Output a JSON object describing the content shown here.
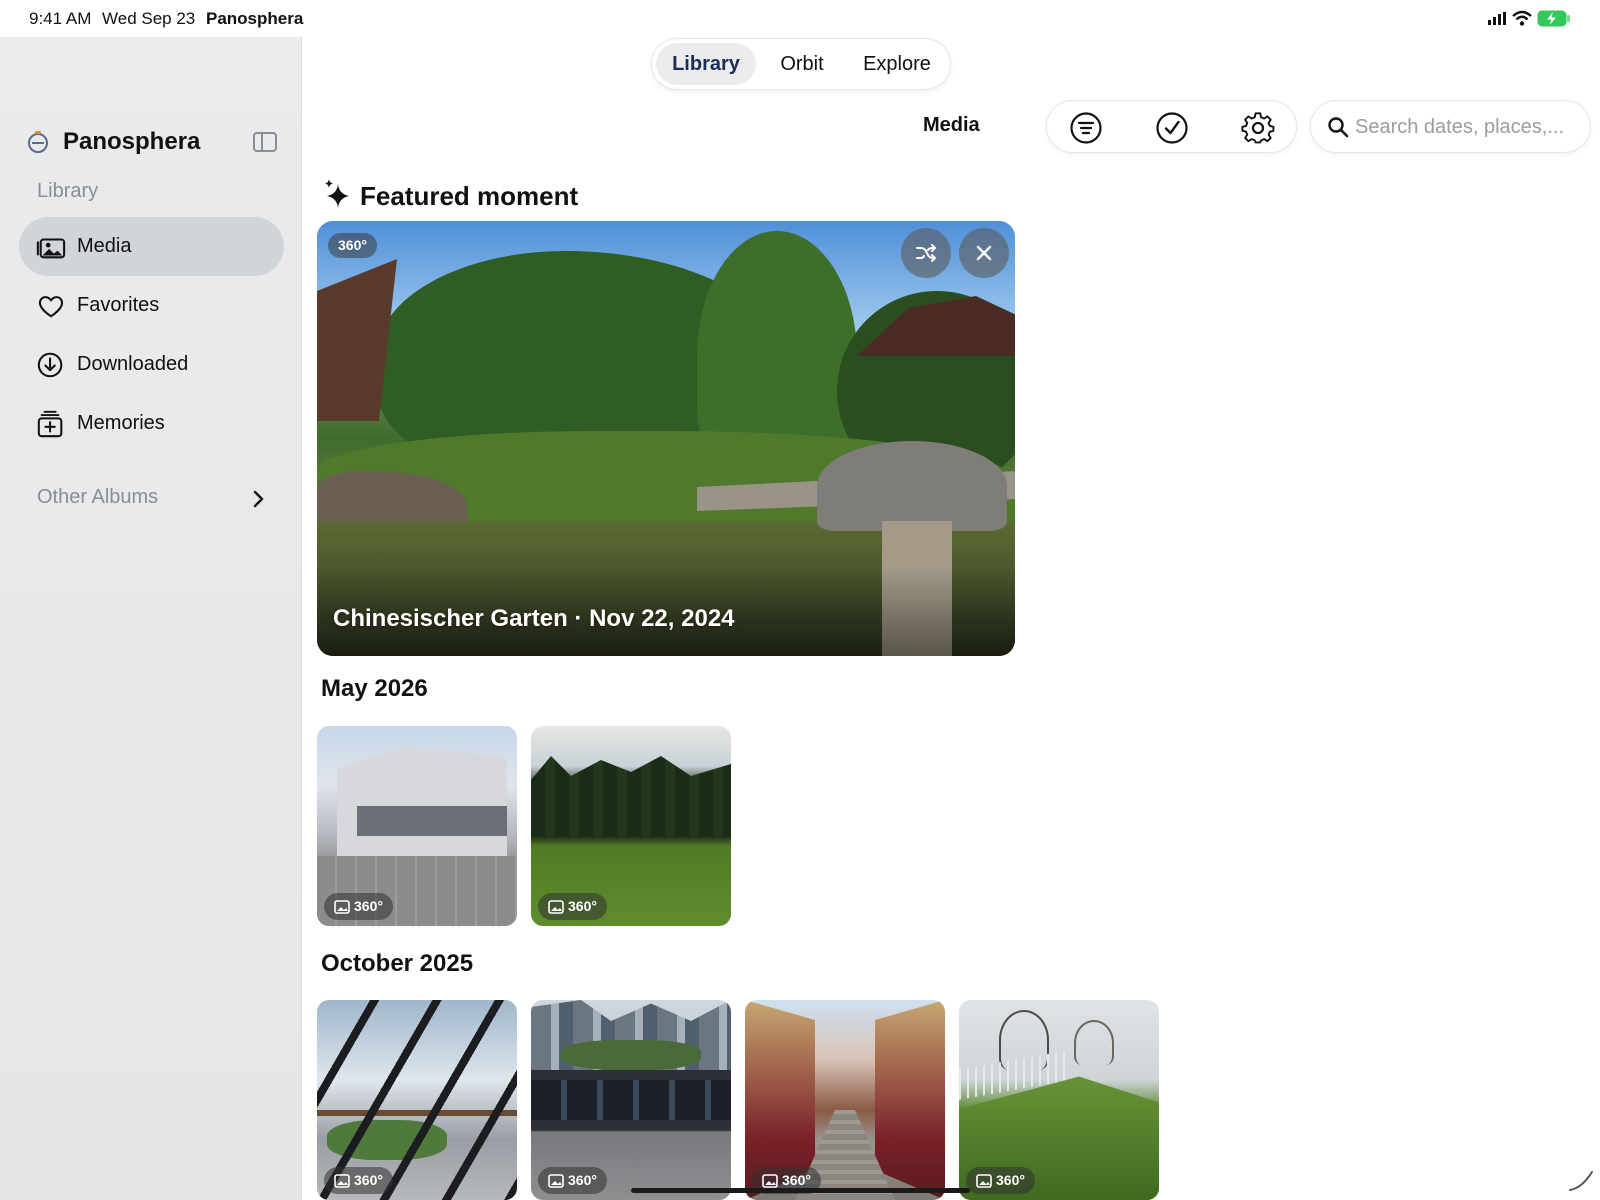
{
  "status_bar": {
    "time": "9:41 AM",
    "date": "Wed Sep 23",
    "app_name": "Panosphera"
  },
  "sidebar": {
    "title": "Panosphera",
    "section_label": "Library",
    "items": [
      {
        "label": "Media",
        "icon": "photo-stack-icon",
        "active": true
      },
      {
        "label": "Favorites",
        "icon": "heart-icon",
        "active": false
      },
      {
        "label": "Downloaded",
        "icon": "download-circle-icon",
        "active": false
      },
      {
        "label": "Memories",
        "icon": "memories-icon",
        "active": false
      }
    ],
    "other_albums_label": "Other Albums"
  },
  "top_tabs": [
    {
      "label": "Library",
      "active": true
    },
    {
      "label": "Orbit",
      "active": false
    },
    {
      "label": "Explore",
      "active": false
    }
  ],
  "toolbar": {
    "title": "Media",
    "buttons": [
      "filter-icon",
      "select-checkmark-icon",
      "settings-gear-icon"
    ],
    "search_placeholder": "Search dates, places,..."
  },
  "featured": {
    "heading": "Featured moment",
    "badge": "360°",
    "caption": "Chinesischer Garten · Nov 22, 2024"
  },
  "sections": [
    {
      "title": "May 2026",
      "items": [
        {
          "badge": "360°",
          "scene": "building"
        },
        {
          "badge": "360°",
          "scene": "meadow"
        }
      ]
    },
    {
      "title": "October 2025",
      "items": [
        {
          "badge": "360°",
          "scene": "glass"
        },
        {
          "badge": "360°",
          "scene": "wall"
        },
        {
          "badge": "360°",
          "scene": "street"
        },
        {
          "badge": "360°",
          "scene": "hill"
        }
      ]
    }
  ],
  "colors": {
    "accent": "#1a2f57",
    "sidebar_bg": "#e7e9eb",
    "active_item_bg": "#d1d4d8",
    "battery": "#34c759"
  }
}
